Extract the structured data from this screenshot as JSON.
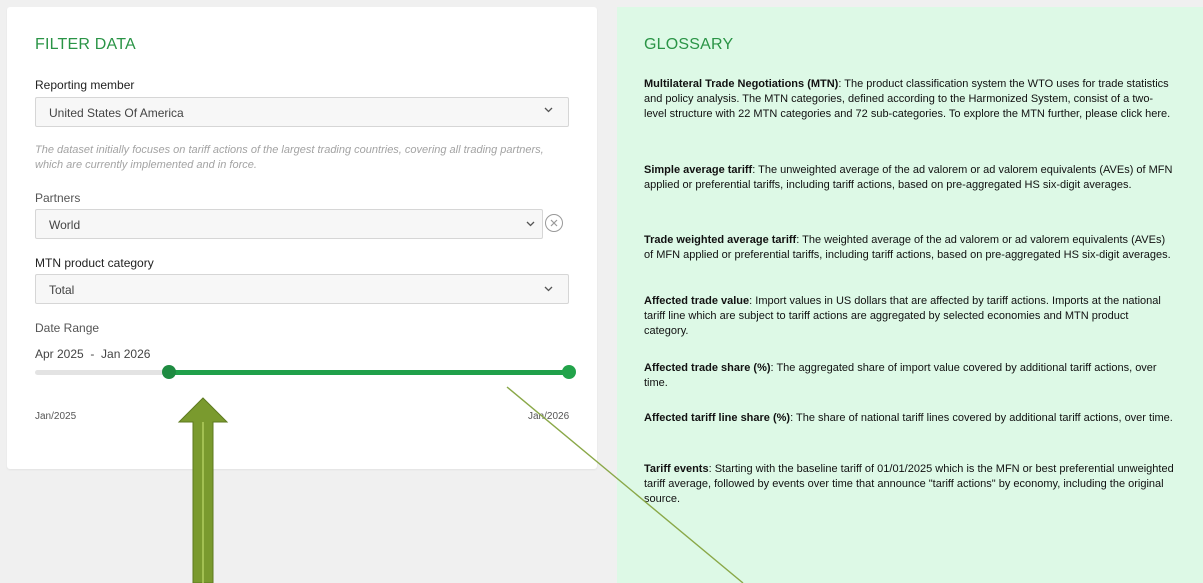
{
  "filter": {
    "title": "FILTER DATA",
    "reporting_member": {
      "label": "Reporting member",
      "value": "United States Of America"
    },
    "note": "The dataset initially focuses on tariff actions of the largest trading countries, covering all trading partners, which are currently implemented and in force.",
    "partners": {
      "label": "Partners",
      "value": "World"
    },
    "mtn_category": {
      "label": "MTN product category",
      "value": "Total"
    },
    "date_range": {
      "label": "Date Range",
      "start": "Apr 2025",
      "separator": "-",
      "end": "Jan 2026",
      "min_label": "Jan/2025",
      "max_label": "Jan/2026",
      "selected_start_fraction": 0.25,
      "selected_end_fraction": 1.0
    }
  },
  "glossary": {
    "title": "GLOSSARY",
    "entries": [
      {
        "term": "Multilateral Trade Negotiations (MTN)",
        "definition": ": The product classification system the WTO uses for trade statistics and policy analysis. The MTN categories, defined according to the Harmonized System, consist of a two-level structure with 22 MTN categories and 72 sub-categories. To explore the MTN further, please click here."
      },
      {
        "term": "Simple average tariff",
        "definition": ": The unweighted average of the ad valorem or ad valorem equivalents (AVEs) of MFN applied or preferential tariffs, including tariff actions, based on pre-aggregated HS six-digit averages."
      },
      {
        "term": "Trade weighted average tariff",
        "definition": ": The weighted average of the ad valorem or ad valorem equivalents (AVEs) of MFN applied or preferential tariffs, including tariff actions, based on pre-aggregated HS six-digit averages."
      },
      {
        "term": "Affected trade value",
        "definition": ": Import values in US dollars that are affected by tariff actions. Imports at the national tariff line which are subject to tariff actions are aggregated by selected economies and MTN product category."
      },
      {
        "term": "Affected trade share (%)",
        "definition": ": The aggregated share of import value covered by additional tariff actions, over time."
      },
      {
        "term": "Affected tariff line share (%)",
        "definition": ": The share of national tariff lines covered by additional tariff actions, over time."
      },
      {
        "term": "Tariff events",
        "definition": ": Starting with the baseline tariff of 01/01/2025 which is the MFN or best preferential unweighted tariff average, followed by events over time that announce \"tariff actions\" by economy, including the original source."
      }
    ]
  },
  "colors": {
    "accent_green": "#2a9446",
    "slider_green": "#20a04a",
    "glossary_bg": "#ddf9e6",
    "annotation_arrow": "#7a9a2e"
  },
  "icons": {
    "dropdown": "chevron-down-icon",
    "clear": "clear-circle-icon"
  }
}
